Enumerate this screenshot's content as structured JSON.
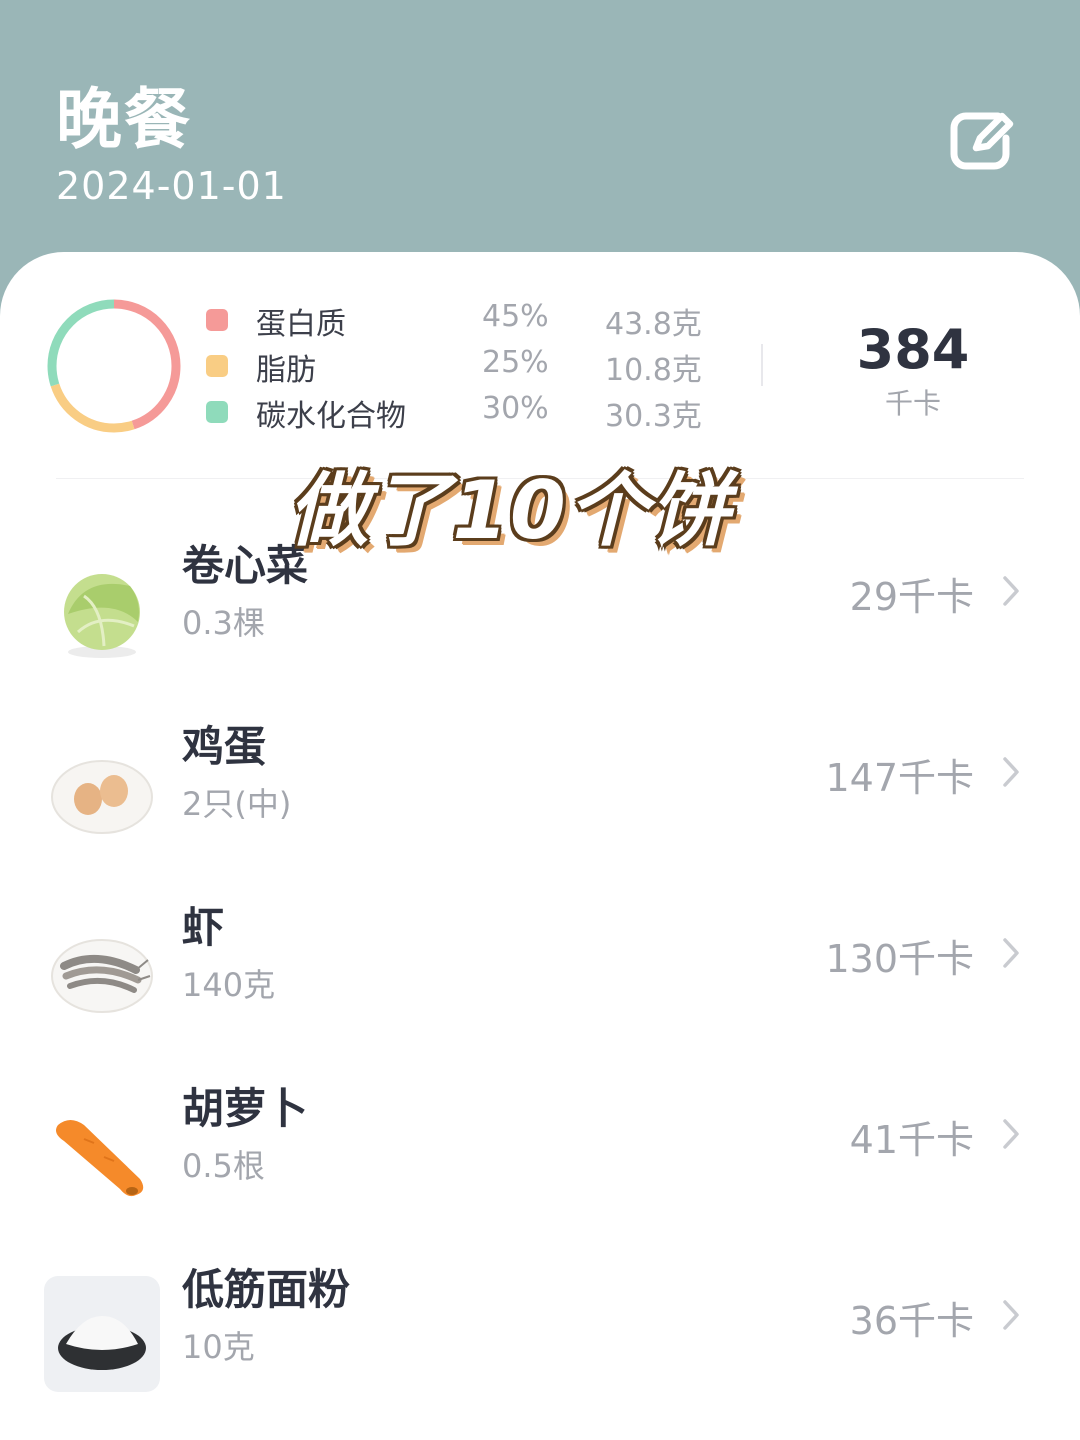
{
  "header": {
    "title": "晚餐",
    "date": "2024-01-01",
    "edit_icon": "edit-icon"
  },
  "summary": {
    "macros": [
      {
        "name": "蛋白质",
        "percent": "45%",
        "amount": "43.8克",
        "color": "#f59a98",
        "fraction": 0.45
      },
      {
        "name": "脂肪",
        "percent": "25%",
        "amount": "10.8克",
        "color": "#f9cd84",
        "fraction": 0.25
      },
      {
        "name": "碳水化合物",
        "percent": "30%",
        "amount": "30.3克",
        "color": "#8fdbbb",
        "fraction": 0.3
      }
    ],
    "total_kcal": "384",
    "total_unit": "千卡"
  },
  "overlay_text": "做了10个饼",
  "foods": [
    {
      "name": "卷心菜",
      "quantity": "0.3棵",
      "kcal": "29千卡",
      "icon": "cabbage-icon"
    },
    {
      "name": "鸡蛋",
      "quantity": "2只(中)",
      "kcal": "147千卡",
      "icon": "eggs-icon"
    },
    {
      "name": "虾",
      "quantity": "140克",
      "kcal": "130千卡",
      "icon": "shrimp-icon"
    },
    {
      "name": "胡萝卜",
      "quantity": "0.5根",
      "kcal": "41千卡",
      "icon": "carrot-icon"
    },
    {
      "name": "低筋面粉",
      "quantity": "10克",
      "kcal": "36千卡",
      "icon": "flour-icon"
    }
  ],
  "colors": {
    "header_bg": "#9ab6b7",
    "text_primary": "#2f3340",
    "text_secondary": "#a3a6ad"
  }
}
